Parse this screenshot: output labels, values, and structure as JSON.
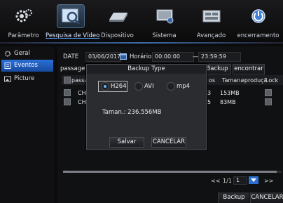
{
  "nav": {
    "items": [
      {
        "label": "Parâmetro",
        "icon": "gear-icon"
      },
      {
        "label": "Pesquisa de Vídeo",
        "icon": "video-search-icon"
      },
      {
        "label": "Dispositivo",
        "icon": "hard-disk-icon"
      },
      {
        "label": "Sistema",
        "icon": "system-monitor-icon"
      },
      {
        "label": "Avançado",
        "icon": "advanced-icon"
      },
      {
        "label": "encerramento",
        "icon": "power-icon"
      }
    ],
    "active_index": 1
  },
  "sidebar": {
    "items": [
      {
        "label": "Geral",
        "icon": "gear-small-icon"
      },
      {
        "label": "Eventos",
        "icon": "events-icon"
      },
      {
        "label": "Picture",
        "icon": "picture-icon"
      }
    ],
    "active_index": 1
  },
  "search": {
    "date_label": "DATE",
    "date_value": "03/06/2017",
    "time_label": "Horário",
    "time_from": "00:00:00",
    "time_separator": "—",
    "time_to": "23:59:59",
    "passagem_label": "passagem",
    "backup_button": "Backup",
    "find_button": "encontrar"
  },
  "table": {
    "headers": [
      "passag",
      "os",
      "Taman.",
      "eproduçã",
      "Lock"
    ],
    "rows": [
      {
        "channel": "CH",
        "count": "3",
        "size": "153MB"
      },
      {
        "channel": "CH",
        "count": "5",
        "size": "83MB"
      }
    ]
  },
  "pager": {
    "prev": "<<",
    "page": "1/1",
    "input": "1",
    "next": ">>"
  },
  "bottom": {
    "backup": "Backup",
    "cancel": "CANCELAR"
  },
  "modal": {
    "title": "Backup Type",
    "options": [
      "H264",
      "AVI",
      "mp4"
    ],
    "selected_index": 0,
    "size_text": "Taman.: 236.556MB",
    "save_button": "Salvar",
    "cancel_button": "CANCELAR"
  },
  "colors": {
    "accent": "#2a6fd6",
    "active_nav": "#3a4d63",
    "radio_on": "#68b6ff"
  }
}
